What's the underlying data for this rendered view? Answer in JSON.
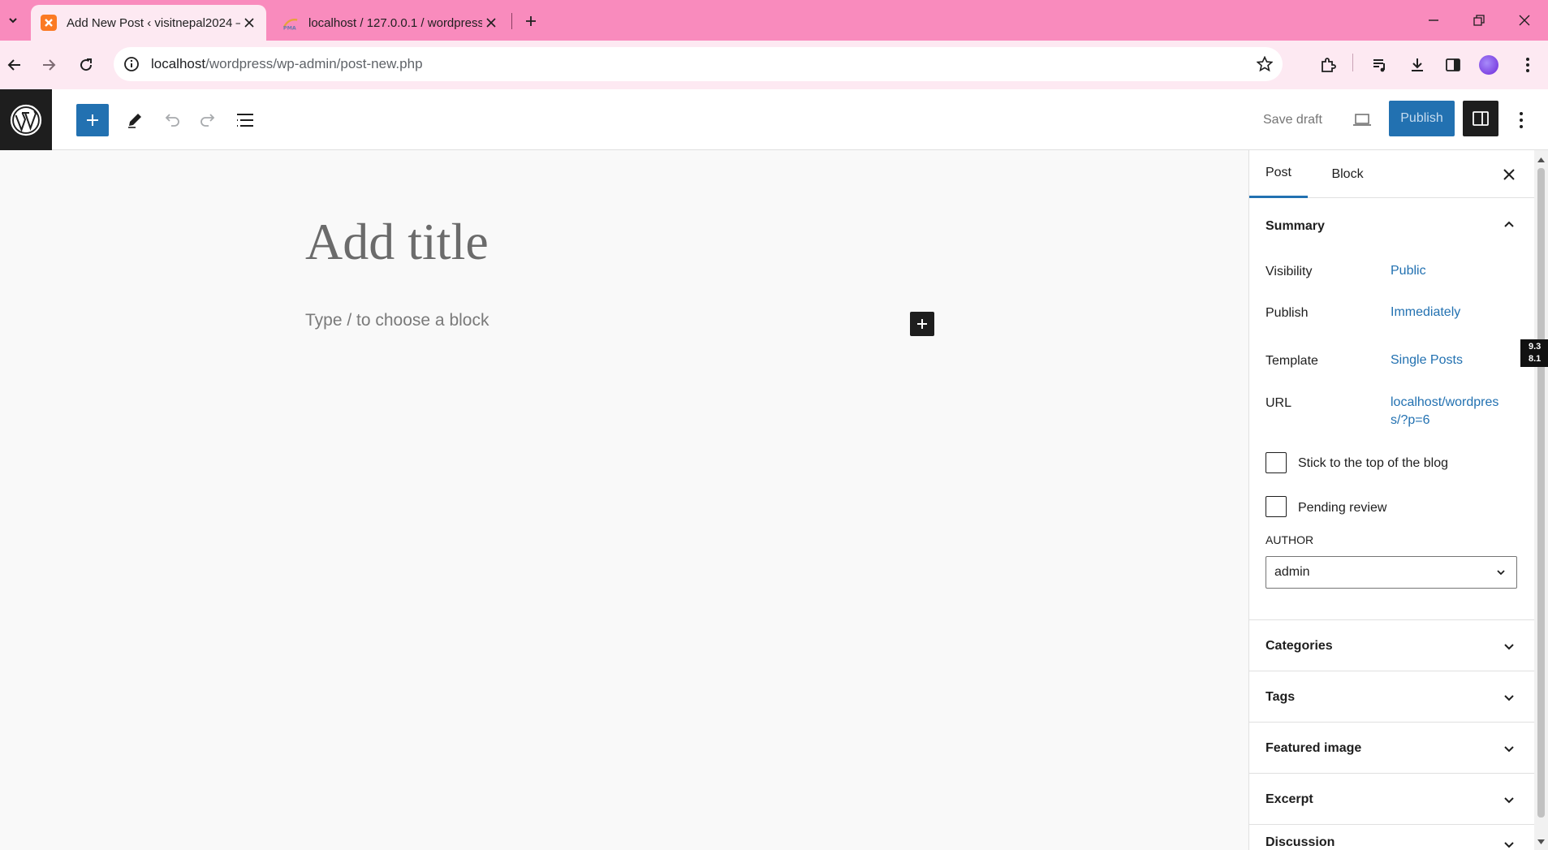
{
  "browser": {
    "tabs": [
      {
        "title": "Add New Post ‹ visitnepal2024 —",
        "active": true
      },
      {
        "title": "localhost / 127.0.0.1 / wordpress",
        "active": false
      }
    ],
    "url_host": "localhost",
    "url_path": "/wordpress/wp-admin/post-new.php"
  },
  "editor_header": {
    "save_draft": "Save draft",
    "publish": "Publish"
  },
  "canvas": {
    "title_placeholder": "Add title",
    "block_placeholder": "Type / to choose a block"
  },
  "sidebar": {
    "tabs": [
      "Post",
      "Block"
    ],
    "summary": {
      "title": "Summary",
      "rows": [
        {
          "label": "Visibility",
          "value": "Public"
        },
        {
          "label": "Publish",
          "value": "Immediately"
        },
        {
          "label": "Template",
          "value": "Single Posts"
        },
        {
          "label": "URL",
          "value_line1": "localhost/wordpres",
          "value_line2": "s/?p=6"
        }
      ],
      "checkboxes": [
        {
          "label": "Stick to the top of the blog",
          "checked": false
        },
        {
          "label": "Pending review",
          "checked": false
        }
      ],
      "author_label": "AUTHOR",
      "author_value": "admin"
    },
    "panels": [
      "Categories",
      "Tags",
      "Featured image",
      "Excerpt",
      "Discussion"
    ]
  },
  "overlay": {
    "line1": "9.3",
    "line2": "8.1"
  },
  "colors": {
    "browser_accent": "#f98bbd",
    "browser_toolbar": "#fde9f2",
    "wp_blue": "#2271b1",
    "wp_dark": "#1e1e1e"
  }
}
